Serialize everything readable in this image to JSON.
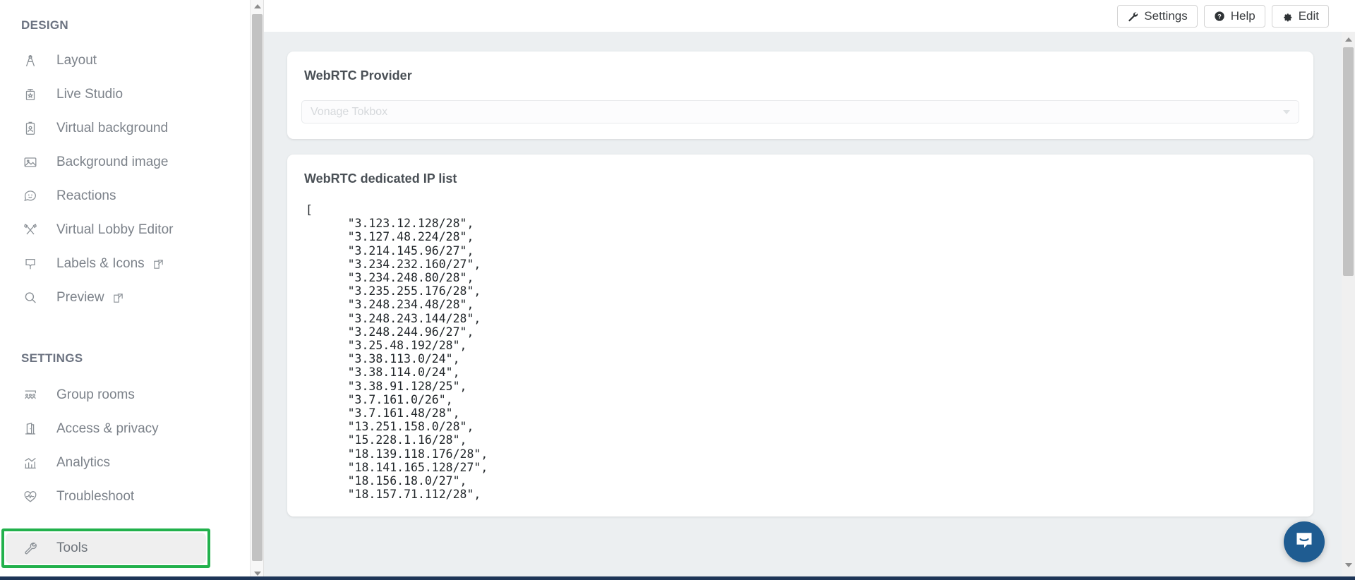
{
  "sidebar": {
    "design_section_title": "DESIGN",
    "settings_section_title": "SETTINGS",
    "design_items": [
      {
        "label": "Layout",
        "icon": "compass-icon",
        "external": false
      },
      {
        "label": "Live Studio",
        "icon": "podium-icon",
        "external": false
      },
      {
        "label": "Virtual background",
        "icon": "id-badge-icon",
        "external": false
      },
      {
        "label": "Background image",
        "icon": "image-icon",
        "external": false
      },
      {
        "label": "Reactions",
        "icon": "smiley-chat-icon",
        "external": false
      },
      {
        "label": "Virtual Lobby Editor",
        "icon": "brushes-icon",
        "external": false
      },
      {
        "label": "Labels & Icons",
        "icon": "label-tag-icon",
        "external": true
      },
      {
        "label": "Preview",
        "icon": "magnifier-icon",
        "external": true
      }
    ],
    "settings_items": [
      {
        "label": "Group rooms",
        "icon": "people-group-icon",
        "external": false
      },
      {
        "label": "Access & privacy",
        "icon": "door-icon",
        "external": false
      },
      {
        "label": "Analytics",
        "icon": "bar-chart-icon",
        "external": false
      },
      {
        "label": "Troubleshoot",
        "icon": "heartbeat-icon",
        "external": false
      }
    ],
    "highlighted_item": {
      "label": "Tools",
      "icon": "wrench-icon"
    },
    "highlight_color": "#22b14c",
    "highlight_row_bg": "#efefef"
  },
  "toolbar": {
    "settings_label": "Settings",
    "help_label": "Help",
    "edit_label": "Edit",
    "settings_icon": "wrench-icon",
    "help_icon": "question-circle-icon",
    "edit_icon": "gear-icon"
  },
  "provider_card": {
    "title": "WebRTC Provider",
    "select_value": "Vonage Tokbox",
    "select_placeholder": "Vonage Tokbox",
    "caret_icon": "chevron-down-icon"
  },
  "ip_card": {
    "title": "WebRTC dedicated IP list",
    "open_bracket": "[",
    "entries": [
      "\"3.123.12.128/28\",",
      "\"3.127.48.224/28\",",
      "\"3.214.145.96/27\",",
      "\"3.234.232.160/27\",",
      "\"3.234.248.80/28\",",
      "\"3.235.255.176/28\",",
      "\"3.248.234.48/28\",",
      "\"3.248.243.144/28\",",
      "\"3.248.244.96/27\",",
      "\"3.25.48.192/28\",",
      "\"3.38.113.0/24\",",
      "\"3.38.114.0/24\",",
      "\"3.38.91.128/25\",",
      "\"3.7.161.0/26\",",
      "\"3.7.161.48/28\",",
      "\"13.251.158.0/28\",",
      "\"15.228.1.16/28\",",
      "\"18.139.118.176/28\",",
      "\"18.141.165.128/27\",",
      "\"18.156.18.0/27\",",
      "\"18.157.71.112/28\","
    ]
  },
  "chat": {
    "launcher_icon": "intercom-message-icon",
    "accent_color": "#1f5c91"
  },
  "scrollbars": {
    "up_arrow_icon": "triangle-up-icon",
    "down_arrow_icon": "triangle-down-icon"
  },
  "colors": {
    "content_bg": "#eceff1",
    "card_bg": "#ffffff",
    "sidebar_bg": "#ffffff",
    "text_muted": "#7c828a"
  }
}
